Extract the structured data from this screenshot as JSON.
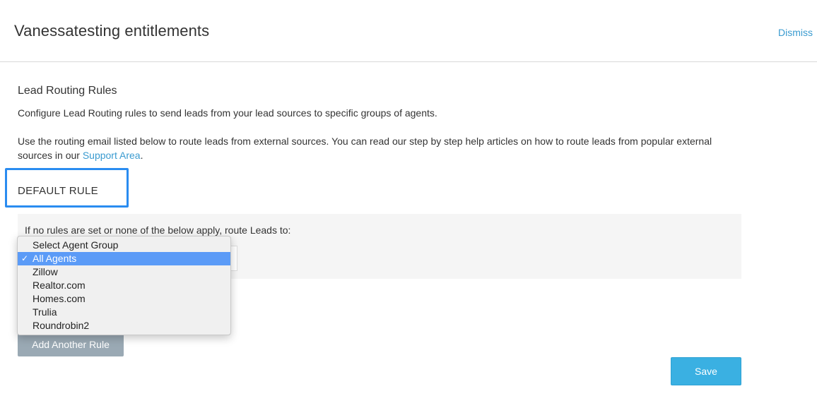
{
  "header": {
    "title": "Vanessatesting entitlements",
    "dismiss_label": "Dismiss"
  },
  "content": {
    "section_title": "Lead Routing Rules",
    "intro": "Configure Lead Routing rules to send leads from your lead sources to specific groups of agents.",
    "routing_text_before": "Use the routing email listed below to route leads from external sources. You can read our step by step help articles on how to route leads from popular external sources in our ",
    "support_link": "Support Area",
    "routing_text_after": "."
  },
  "default_rule": {
    "label": "DEFAULT RULE",
    "description": "If no rules are set or none of the below apply, route Leads to:",
    "options": [
      "Select Agent Group",
      "All Agents",
      "Zillow",
      "Realtor.com",
      "Homes.com",
      "Trulia",
      "Roundrobin2"
    ],
    "selected": "All Agents",
    "check_glyph": "✓"
  },
  "actions": {
    "add_rule_label": "Add Another Rule",
    "save_label": "Save"
  },
  "colors": {
    "link": "#3a9bd0",
    "highlight_box": "#2a8cf0",
    "selected_option": "#5b9bf7",
    "save_button": "#3ab0e2",
    "add_rule_button": "#9aa9b4"
  }
}
